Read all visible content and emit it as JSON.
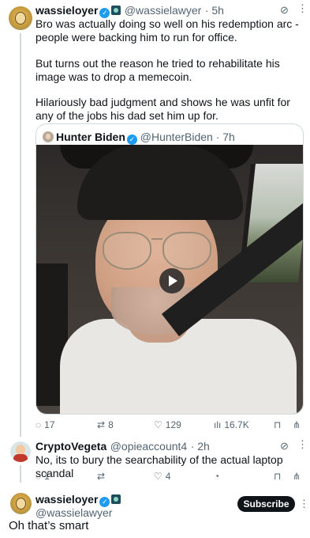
{
  "tweet_main": {
    "display_name": "wassieloyer",
    "handle": "@wassielawyer",
    "time": "· 5h",
    "paragraphs": [
      "Bro was actually doing so well on his redemption arc - people were backing him to run for office.",
      "But turns out the reason he tried to rehabilitate his image was to drop a memecoin.",
      "Hilariously bad judgment and shows he was unfit for any of the jobs his dad set him up for."
    ],
    "quote": {
      "display_name": "Hunter Biden",
      "handle": "@HunterBiden",
      "time": "· 7h"
    },
    "actions": {
      "replies": "17",
      "reposts": "8",
      "likes": "129",
      "views": "16.7K"
    }
  },
  "reply_1": {
    "display_name": "CryptoVegeta",
    "handle": "@opieaccount4",
    "time": "· 2h",
    "text": "No, its to bury the searchability of the actual laptop scandal",
    "actions": {
      "replies": "1",
      "reposts": "",
      "likes": "4"
    }
  },
  "reply_2": {
    "display_name": "wassieloyer",
    "handle": "@wassielawyer",
    "subscribe_label": "Subscribe",
    "text": "Oh that’s smart"
  },
  "colors": {
    "accent": "#1d9bf0",
    "text": "#0f1419",
    "muted": "#536471",
    "border": "#cfd9de"
  },
  "icons": {
    "grok": "grok-icon",
    "more": "more-icon",
    "reply": "reply-icon",
    "repost": "repost-icon",
    "like": "heart-icon",
    "views": "views-icon",
    "bookmark": "bookmark-icon",
    "share": "share-icon",
    "tip": "tip-icon",
    "play": "play-icon"
  }
}
